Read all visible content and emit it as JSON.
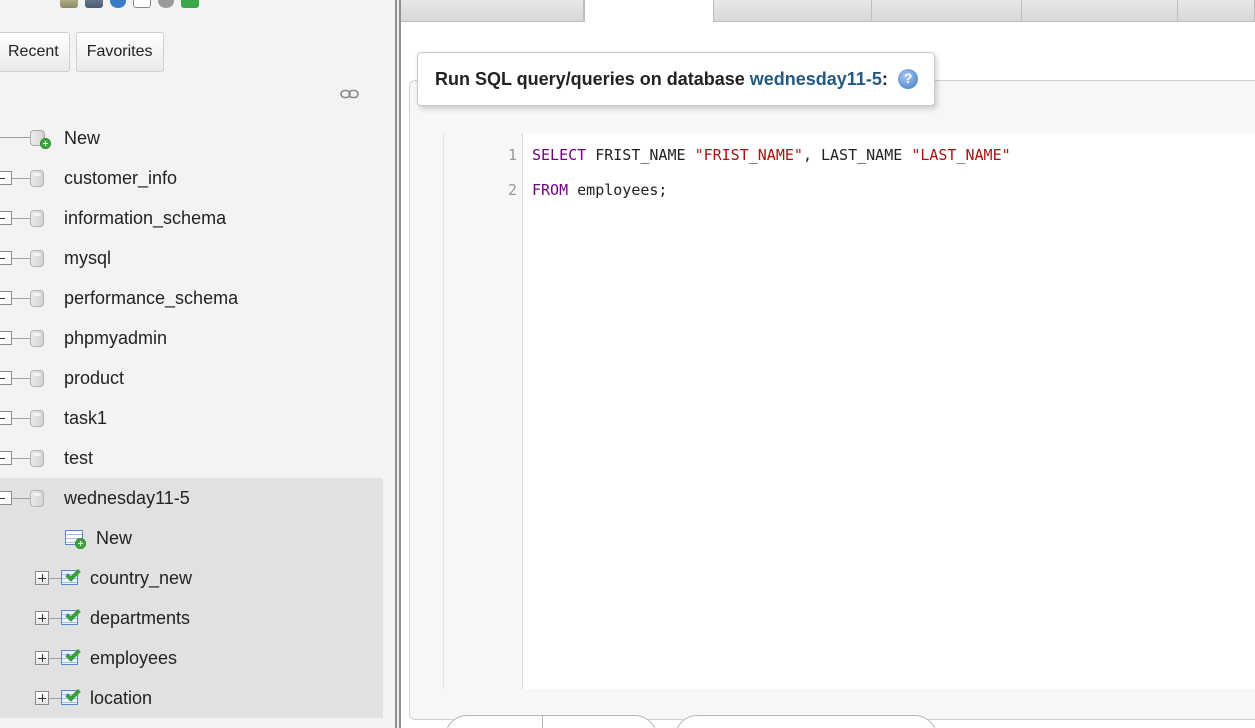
{
  "sidebar": {
    "tabs": [
      {
        "label": "Recent"
      },
      {
        "label": "Favorites"
      }
    ],
    "link_icon": "link-icon",
    "tree": [
      {
        "label": "New",
        "type": "new",
        "level": 0
      },
      {
        "label": "customer_info",
        "type": "database",
        "level": 0
      },
      {
        "label": "information_schema",
        "type": "database",
        "level": 0
      },
      {
        "label": "mysql",
        "type": "database",
        "level": 0
      },
      {
        "label": "performance_schema",
        "type": "database",
        "level": 0
      },
      {
        "label": "phpmyadmin",
        "type": "database",
        "level": 0
      },
      {
        "label": "product",
        "type": "database",
        "level": 0
      },
      {
        "label": "task1",
        "type": "database",
        "level": 0
      },
      {
        "label": "test",
        "type": "database",
        "level": 0
      },
      {
        "label": "wednesday11-5",
        "type": "database",
        "level": 0,
        "selected": true,
        "expanded": true
      },
      {
        "label": "New",
        "type": "new-table",
        "level": 1
      },
      {
        "label": "country_new",
        "type": "table",
        "level": 1
      },
      {
        "label": "departments",
        "type": "table",
        "level": 1
      },
      {
        "label": "employees",
        "type": "table",
        "level": 1
      },
      {
        "label": "location",
        "type": "table",
        "level": 1
      }
    ]
  },
  "query_panel": {
    "legend_prefix": "Run SQL query/queries on database",
    "database_name": "wednesday11-5",
    "legend_suffix": ":",
    "help_icon": "help-icon"
  },
  "editor": {
    "line_numbers": [
      "1",
      "2"
    ],
    "lines": [
      [
        {
          "text": "SELECT",
          "kind": "keyword"
        },
        {
          "text": " FRIST_NAME ",
          "kind": "plain"
        },
        {
          "text": "\"FRIST_NAME\"",
          "kind": "string"
        },
        {
          "text": ", LAST_NAME ",
          "kind": "plain"
        },
        {
          "text": "\"LAST_NAME\"",
          "kind": "string"
        }
      ],
      [
        {
          "text": "FROM",
          "kind": "keyword"
        },
        {
          "text": " employees;",
          "kind": "plain"
        }
      ]
    ]
  },
  "colors": {
    "keyword": "#770088",
    "string": "#aa1111",
    "db_link": "#235a81",
    "selected_row": "#e1e1e1"
  }
}
